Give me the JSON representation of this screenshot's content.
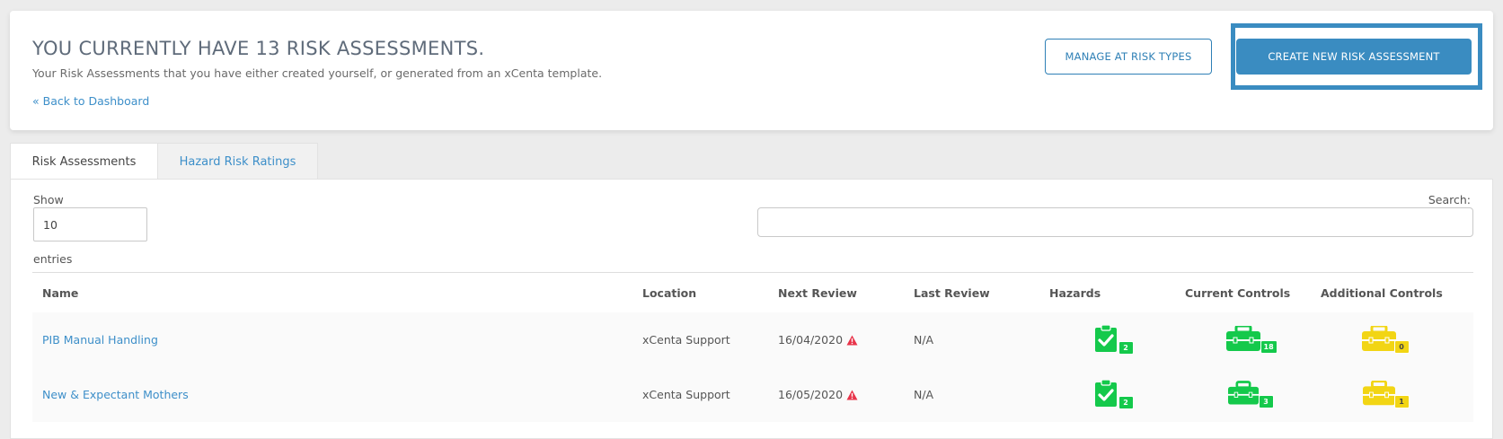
{
  "header": {
    "title": "YOU CURRENTLY HAVE 13 RISK ASSESSMENTS.",
    "subtitle": "Your Risk Assessments that you have either created yourself, or generated from an xCenta template.",
    "back_link": "« Back to Dashboard",
    "manage_button": "MANAGE AT RISK TYPES",
    "create_button": "CREATE NEW RISK ASSESSMENT"
  },
  "tabs": [
    {
      "label": "Risk Assessments",
      "active": true
    },
    {
      "label": "Hazard Risk Ratings",
      "active": false
    }
  ],
  "controls": {
    "show_label": "Show",
    "show_value": "10",
    "entries_label": "entries",
    "search_label": "Search:",
    "search_value": ""
  },
  "table": {
    "columns": [
      "Name",
      "Location",
      "Next Review",
      "Last Review",
      "Hazards",
      "Current Controls",
      "Additional Controls"
    ],
    "rows": [
      {
        "name": "PIB Manual Handling",
        "location": "xCenta Support",
        "next_review": "16/04/2020",
        "last_review": "N/A",
        "hazards": "2",
        "current_controls": "18",
        "additional_controls": "0"
      },
      {
        "name": "New & Expectant Mothers",
        "location": "xCenta Support",
        "next_review": "16/05/2020",
        "last_review": "N/A",
        "hazards": "2",
        "current_controls": "3",
        "additional_controls": "1"
      }
    ]
  },
  "colors": {
    "accent": "#3a8cc1",
    "link": "#3d8fc9",
    "green": "#14c94b",
    "yellow": "#f2d514",
    "warning": "#e8344a"
  },
  "icons": {
    "hazards": "clipboard-check-icon",
    "current_controls": "toolbox-icon",
    "additional_controls": "toolbox-icon",
    "overdue": "warning-triangle-icon"
  }
}
